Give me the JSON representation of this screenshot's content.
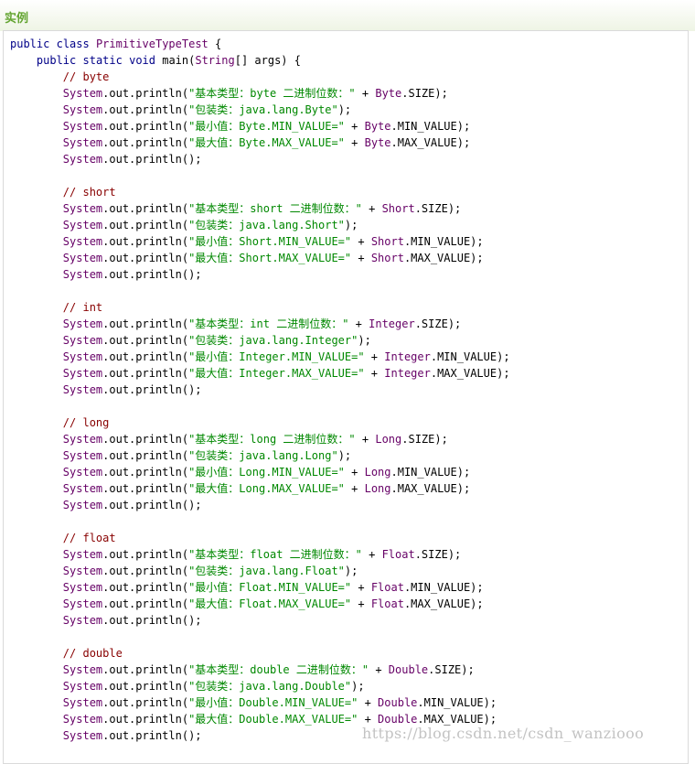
{
  "section": {
    "title": "实例"
  },
  "code": {
    "lines": [
      [
        [
          "kw",
          "public"
        ],
        [
          "pl",
          " "
        ],
        [
          "kw",
          "class"
        ],
        [
          "pl",
          " "
        ],
        [
          "cls",
          "PrimitiveTypeTest"
        ],
        [
          "pl",
          " {"
        ]
      ],
      [
        [
          "pl",
          "    "
        ],
        [
          "kw",
          "public"
        ],
        [
          "pl",
          " "
        ],
        [
          "kw",
          "static"
        ],
        [
          "pl",
          " "
        ],
        [
          "kw",
          "void"
        ],
        [
          "pl",
          " main("
        ],
        [
          "cls",
          "String"
        ],
        [
          "pl",
          "[] args) {"
        ]
      ],
      [
        [
          "pl",
          "        "
        ],
        [
          "com",
          "// byte"
        ]
      ],
      [
        [
          "pl",
          "        "
        ],
        [
          "cls",
          "System"
        ],
        [
          "pl",
          ".out.println("
        ],
        [
          "str",
          "\"基本类型：byte 二进制位数：\""
        ],
        [
          "pl",
          " + "
        ],
        [
          "cls",
          "Byte"
        ],
        [
          "pl",
          ".SIZE);"
        ]
      ],
      [
        [
          "pl",
          "        "
        ],
        [
          "cls",
          "System"
        ],
        [
          "pl",
          ".out.println("
        ],
        [
          "str",
          "\"包装类：java.lang.Byte\""
        ],
        [
          "pl",
          ");"
        ]
      ],
      [
        [
          "pl",
          "        "
        ],
        [
          "cls",
          "System"
        ],
        [
          "pl",
          ".out.println("
        ],
        [
          "str",
          "\"最小值：Byte.MIN_VALUE=\""
        ],
        [
          "pl",
          " + "
        ],
        [
          "cls",
          "Byte"
        ],
        [
          "pl",
          ".MIN_VALUE);"
        ]
      ],
      [
        [
          "pl",
          "        "
        ],
        [
          "cls",
          "System"
        ],
        [
          "pl",
          ".out.println("
        ],
        [
          "str",
          "\"最大值：Byte.MAX_VALUE=\""
        ],
        [
          "pl",
          " + "
        ],
        [
          "cls",
          "Byte"
        ],
        [
          "pl",
          ".MAX_VALUE);"
        ]
      ],
      [
        [
          "pl",
          "        "
        ],
        [
          "cls",
          "System"
        ],
        [
          "pl",
          ".out.println();"
        ]
      ],
      [
        [
          "pl",
          ""
        ]
      ],
      [
        [
          "pl",
          "        "
        ],
        [
          "com",
          "// short"
        ]
      ],
      [
        [
          "pl",
          "        "
        ],
        [
          "cls",
          "System"
        ],
        [
          "pl",
          ".out.println("
        ],
        [
          "str",
          "\"基本类型：short 二进制位数：\""
        ],
        [
          "pl",
          " + "
        ],
        [
          "cls",
          "Short"
        ],
        [
          "pl",
          ".SIZE);"
        ]
      ],
      [
        [
          "pl",
          "        "
        ],
        [
          "cls",
          "System"
        ],
        [
          "pl",
          ".out.println("
        ],
        [
          "str",
          "\"包装类：java.lang.Short\""
        ],
        [
          "pl",
          ");"
        ]
      ],
      [
        [
          "pl",
          "        "
        ],
        [
          "cls",
          "System"
        ],
        [
          "pl",
          ".out.println("
        ],
        [
          "str",
          "\"最小值：Short.MIN_VALUE=\""
        ],
        [
          "pl",
          " + "
        ],
        [
          "cls",
          "Short"
        ],
        [
          "pl",
          ".MIN_VALUE);"
        ]
      ],
      [
        [
          "pl",
          "        "
        ],
        [
          "cls",
          "System"
        ],
        [
          "pl",
          ".out.println("
        ],
        [
          "str",
          "\"最大值：Short.MAX_VALUE=\""
        ],
        [
          "pl",
          " + "
        ],
        [
          "cls",
          "Short"
        ],
        [
          "pl",
          ".MAX_VALUE);"
        ]
      ],
      [
        [
          "pl",
          "        "
        ],
        [
          "cls",
          "System"
        ],
        [
          "pl",
          ".out.println();"
        ]
      ],
      [
        [
          "pl",
          ""
        ]
      ],
      [
        [
          "pl",
          "        "
        ],
        [
          "com",
          "// int"
        ]
      ],
      [
        [
          "pl",
          "        "
        ],
        [
          "cls",
          "System"
        ],
        [
          "pl",
          ".out.println("
        ],
        [
          "str",
          "\"基本类型：int 二进制位数：\""
        ],
        [
          "pl",
          " + "
        ],
        [
          "cls",
          "Integer"
        ],
        [
          "pl",
          ".SIZE);"
        ]
      ],
      [
        [
          "pl",
          "        "
        ],
        [
          "cls",
          "System"
        ],
        [
          "pl",
          ".out.println("
        ],
        [
          "str",
          "\"包装类：java.lang.Integer\""
        ],
        [
          "pl",
          ");"
        ]
      ],
      [
        [
          "pl",
          "        "
        ],
        [
          "cls",
          "System"
        ],
        [
          "pl",
          ".out.println("
        ],
        [
          "str",
          "\"最小值：Integer.MIN_VALUE=\""
        ],
        [
          "pl",
          " + "
        ],
        [
          "cls",
          "Integer"
        ],
        [
          "pl",
          ".MIN_VALUE);"
        ]
      ],
      [
        [
          "pl",
          "        "
        ],
        [
          "cls",
          "System"
        ],
        [
          "pl",
          ".out.println("
        ],
        [
          "str",
          "\"最大值：Integer.MAX_VALUE=\""
        ],
        [
          "pl",
          " + "
        ],
        [
          "cls",
          "Integer"
        ],
        [
          "pl",
          ".MAX_VALUE);"
        ]
      ],
      [
        [
          "pl",
          "        "
        ],
        [
          "cls",
          "System"
        ],
        [
          "pl",
          ".out.println();"
        ]
      ],
      [
        [
          "pl",
          ""
        ]
      ],
      [
        [
          "pl",
          "        "
        ],
        [
          "com",
          "// long"
        ]
      ],
      [
        [
          "pl",
          "        "
        ],
        [
          "cls",
          "System"
        ],
        [
          "pl",
          ".out.println("
        ],
        [
          "str",
          "\"基本类型：long 二进制位数：\""
        ],
        [
          "pl",
          " + "
        ],
        [
          "cls",
          "Long"
        ],
        [
          "pl",
          ".SIZE);"
        ]
      ],
      [
        [
          "pl",
          "        "
        ],
        [
          "cls",
          "System"
        ],
        [
          "pl",
          ".out.println("
        ],
        [
          "str",
          "\"包装类：java.lang.Long\""
        ],
        [
          "pl",
          ");"
        ]
      ],
      [
        [
          "pl",
          "        "
        ],
        [
          "cls",
          "System"
        ],
        [
          "pl",
          ".out.println("
        ],
        [
          "str",
          "\"最小值：Long.MIN_VALUE=\""
        ],
        [
          "pl",
          " + "
        ],
        [
          "cls",
          "Long"
        ],
        [
          "pl",
          ".MIN_VALUE);"
        ]
      ],
      [
        [
          "pl",
          "        "
        ],
        [
          "cls",
          "System"
        ],
        [
          "pl",
          ".out.println("
        ],
        [
          "str",
          "\"最大值：Long.MAX_VALUE=\""
        ],
        [
          "pl",
          " + "
        ],
        [
          "cls",
          "Long"
        ],
        [
          "pl",
          ".MAX_VALUE);"
        ]
      ],
      [
        [
          "pl",
          "        "
        ],
        [
          "cls",
          "System"
        ],
        [
          "pl",
          ".out.println();"
        ]
      ],
      [
        [
          "pl",
          ""
        ]
      ],
      [
        [
          "pl",
          "        "
        ],
        [
          "com",
          "// float"
        ]
      ],
      [
        [
          "pl",
          "        "
        ],
        [
          "cls",
          "System"
        ],
        [
          "pl",
          ".out.println("
        ],
        [
          "str",
          "\"基本类型：float 二进制位数：\""
        ],
        [
          "pl",
          " + "
        ],
        [
          "cls",
          "Float"
        ],
        [
          "pl",
          ".SIZE);"
        ]
      ],
      [
        [
          "pl",
          "        "
        ],
        [
          "cls",
          "System"
        ],
        [
          "pl",
          ".out.println("
        ],
        [
          "str",
          "\"包装类：java.lang.Float\""
        ],
        [
          "pl",
          ");"
        ]
      ],
      [
        [
          "pl",
          "        "
        ],
        [
          "cls",
          "System"
        ],
        [
          "pl",
          ".out.println("
        ],
        [
          "str",
          "\"最小值：Float.MIN_VALUE=\""
        ],
        [
          "pl",
          " + "
        ],
        [
          "cls",
          "Float"
        ],
        [
          "pl",
          ".MIN_VALUE);"
        ]
      ],
      [
        [
          "pl",
          "        "
        ],
        [
          "cls",
          "System"
        ],
        [
          "pl",
          ".out.println("
        ],
        [
          "str",
          "\"最大值：Float.MAX_VALUE=\""
        ],
        [
          "pl",
          " + "
        ],
        [
          "cls",
          "Float"
        ],
        [
          "pl",
          ".MAX_VALUE);"
        ]
      ],
      [
        [
          "pl",
          "        "
        ],
        [
          "cls",
          "System"
        ],
        [
          "pl",
          ".out.println();"
        ]
      ],
      [
        [
          "pl",
          ""
        ]
      ],
      [
        [
          "pl",
          "        "
        ],
        [
          "com",
          "// double"
        ]
      ],
      [
        [
          "pl",
          "        "
        ],
        [
          "cls",
          "System"
        ],
        [
          "pl",
          ".out.println("
        ],
        [
          "str",
          "\"基本类型：double 二进制位数：\""
        ],
        [
          "pl",
          " + "
        ],
        [
          "cls",
          "Double"
        ],
        [
          "pl",
          ".SIZE);"
        ]
      ],
      [
        [
          "pl",
          "        "
        ],
        [
          "cls",
          "System"
        ],
        [
          "pl",
          ".out.println("
        ],
        [
          "str",
          "\"包装类：java.lang.Double\""
        ],
        [
          "pl",
          ");"
        ]
      ],
      [
        [
          "pl",
          "        "
        ],
        [
          "cls",
          "System"
        ],
        [
          "pl",
          ".out.println("
        ],
        [
          "str",
          "\"最小值：Double.MIN_VALUE=\""
        ],
        [
          "pl",
          " + "
        ],
        [
          "cls",
          "Double"
        ],
        [
          "pl",
          ".MIN_VALUE);"
        ]
      ],
      [
        [
          "pl",
          "        "
        ],
        [
          "cls",
          "System"
        ],
        [
          "pl",
          ".out.println("
        ],
        [
          "str",
          "\"最大值：Double.MAX_VALUE=\""
        ],
        [
          "pl",
          " + "
        ],
        [
          "cls",
          "Double"
        ],
        [
          "pl",
          ".MAX_VALUE);"
        ]
      ],
      [
        [
          "pl",
          "        "
        ],
        [
          "cls",
          "System"
        ],
        [
          "pl",
          ".out.println();"
        ]
      ]
    ]
  },
  "watermark": {
    "text": "https://blog.csdn.net/csdn_wanziooo"
  }
}
